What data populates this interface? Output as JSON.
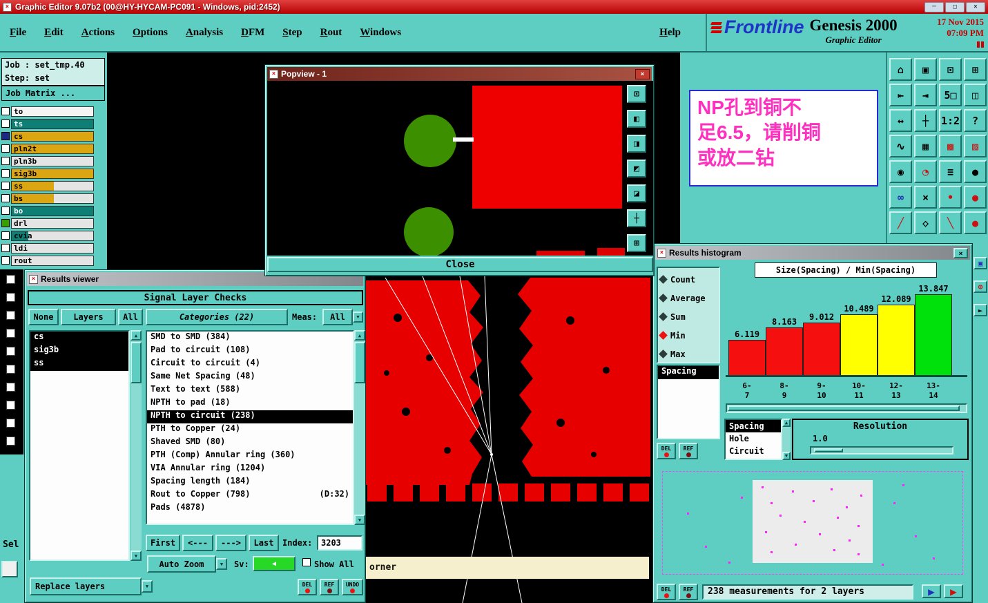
{
  "icons": {
    "app": "×",
    "minimize": "─",
    "maximize": "□",
    "close": "×",
    "up": "▲",
    "down": "▼",
    "left": "◀",
    "right": "▶",
    "dropdown": "▼",
    "window_icon": "×"
  },
  "window": {
    "title": "Graphic Editor 9.07b2 (00@HY-HYCAM-PC091 - Windows, pid:2452)"
  },
  "menubar": {
    "items": [
      "File",
      "Edit",
      "Actions",
      "Options",
      "Analysis",
      "DFM",
      "Step",
      "Rout",
      "Windows"
    ],
    "help": "Help"
  },
  "brand": {
    "logo": "Frontline",
    "product": "Genesis 2000",
    "date": "17 Nov 2015",
    "time": "07:09 PM",
    "subtitle": "Graphic Editor"
  },
  "job_panel": {
    "job": "Job : set_tmp.40",
    "step": "Step: set",
    "matrix": "Job Matrix ...",
    "sel_label": "Sel",
    "layers": [
      {
        "name": "to",
        "bar": "#f4f4f4",
        "fg": "#000000",
        "check": "#ffffff",
        "w": "100%"
      },
      {
        "name": "ts",
        "bar": "#0f7e75",
        "fg": "#ffffff",
        "check": "#ffffff",
        "w": "100%"
      },
      {
        "name": "cs",
        "bar": "#dca613",
        "fg": "#000000",
        "check": "#1b2a86",
        "w": "100%"
      },
      {
        "name": "pln2t",
        "bar": "#dca613",
        "fg": "#000000",
        "check": "#ffffff",
        "w": "100%"
      },
      {
        "name": "pln3b",
        "bar": "#e4e4e4",
        "fg": "#000000",
        "check": "#ffffff",
        "w": "100%"
      },
      {
        "name": "sig3b",
        "bar": "#dca613",
        "fg": "#000000",
        "check": "#ffffff",
        "w": "100%"
      },
      {
        "name": "ss",
        "bar": "#dca613",
        "fg": "#000000",
        "check": "#ffffff",
        "w": "52%"
      },
      {
        "name": "bs",
        "bar": "#dca613",
        "fg": "#000000",
        "check": "#ffffff",
        "w": "52%"
      },
      {
        "name": "bo",
        "bar": "#0f7e75",
        "fg": "#ffffff",
        "check": "#ffffff",
        "w": "100%"
      },
      {
        "name": "drl",
        "bar": "#e4e4e4",
        "fg": "#000000",
        "check": "#36a000",
        "w": "100%"
      },
      {
        "name": "cvia",
        "bar": "#0f7e75",
        "fg": "#000000",
        "check": "#ffffff",
        "w": "20%"
      },
      {
        "name": "ldi",
        "bar": "#e4e4e4",
        "fg": "#000000",
        "check": "#ffffff",
        "w": "100%"
      },
      {
        "name": "rout",
        "bar": "#e4e4e4",
        "fg": "#000000",
        "check": "#ffffff",
        "w": "100%"
      }
    ]
  },
  "popview": {
    "title": "Popview - 1",
    "close_label": "Close",
    "tools": [
      {
        "icon": "⊡",
        "name": "view-box-icon"
      },
      {
        "icon": "◧",
        "name": "half-left-icon"
      },
      {
        "icon": "◨",
        "name": "half-right-icon"
      },
      {
        "icon": "◩",
        "name": "corner-view-icon"
      },
      {
        "icon": "◪",
        "name": "corner-view2-icon"
      },
      {
        "icon": "┼",
        "name": "pan-cross-icon"
      },
      {
        "icon": "⊞",
        "name": "grid-center-icon"
      }
    ]
  },
  "results_viewer": {
    "title": "Results viewer",
    "header": "Signal Layer Checks",
    "none_btn": "None",
    "layers_btn": "Layers",
    "all_btn": "All",
    "categories_header": "Categories (22)",
    "meas_label": "Meas:",
    "meas_value": "All",
    "layer_items": [
      {
        "label": "cs"
      },
      {
        "label": "sig3b"
      },
      {
        "label": "ss"
      }
    ],
    "categories": [
      {
        "label": "SMD to SMD (384)",
        "extra": "",
        "selected": false
      },
      {
        "label": "Pad to circuit (108)",
        "extra": "",
        "selected": false
      },
      {
        "label": "Circuit to circuit (4)",
        "extra": "",
        "selected": false
      },
      {
        "label": "Same Net Spacing (48)",
        "extra": "",
        "selected": false
      },
      {
        "label": "Text to text (588)",
        "extra": "",
        "selected": false
      },
      {
        "label": "NPTH to pad (18)",
        "extra": "",
        "selected": false
      },
      {
        "label": "NPTH to circuit (238)",
        "extra": "",
        "selected": true
      },
      {
        "label": "PTH to Copper (24)",
        "extra": "",
        "selected": false
      },
      {
        "label": "Shaved SMD (80)",
        "extra": "",
        "selected": false
      },
      {
        "label": "PTH (Comp) Annular ring (360)",
        "extra": "",
        "selected": false
      },
      {
        "label": "VIA Annular ring (1204)",
        "extra": "",
        "selected": false
      },
      {
        "label": "Spacing length (184)",
        "extra": "",
        "selected": false
      },
      {
        "label": "Rout to Copper (798)",
        "extra": "(D:32)",
        "selected": false
      },
      {
        "label": "Pads (4878)",
        "extra": "",
        "selected": false
      }
    ],
    "nav": {
      "first": "First",
      "prev": "<---",
      "next": "--->",
      "last": "Last",
      "index_label": "Index:",
      "index_value": "3203"
    },
    "auto_zoom": "Auto Zoom",
    "sv_label": "Sv:",
    "sv_color": "#27d827",
    "show_all": "Show All",
    "replace_layers": "Replace layers",
    "del_btn": "DEL",
    "ref_btn": "REF",
    "undo_btn": "UNDO"
  },
  "histogram": {
    "title": "Results histogram",
    "stats": [
      {
        "label": "Count",
        "selected": false
      },
      {
        "label": "Average",
        "selected": false
      },
      {
        "label": "Sum",
        "selected": false
      },
      {
        "label": "Min",
        "selected": true
      },
      {
        "label": "Max",
        "selected": false
      }
    ],
    "series": [
      {
        "label": "Spacing",
        "selected": true
      }
    ],
    "measures": [
      {
        "label": "Spacing",
        "selected": true
      },
      {
        "label": "Hole",
        "selected": false
      },
      {
        "label": "Circuit",
        "selected": false
      }
    ],
    "resolution_label": "Resolution",
    "resolution_value": "1.0",
    "status": "238 measurements for 2 layers",
    "del_btn": "DEL",
    "ref_btn": "REF",
    "map_dots": [
      [
        33,
        14
      ],
      [
        43,
        18
      ],
      [
        56,
        16
      ],
      [
        66,
        22
      ],
      [
        36,
        30
      ],
      [
        50,
        28
      ],
      [
        61,
        34
      ],
      [
        39,
        42
      ],
      [
        47,
        48
      ],
      [
        58,
        44
      ],
      [
        65,
        52
      ],
      [
        34,
        58
      ],
      [
        52,
        60
      ],
      [
        62,
        66
      ],
      [
        44,
        70
      ],
      [
        57,
        76
      ],
      [
        36,
        78
      ],
      [
        65,
        80
      ],
      [
        26,
        24
      ],
      [
        8,
        40
      ],
      [
        14,
        72
      ],
      [
        22,
        88
      ],
      [
        77,
        30
      ],
      [
        84,
        62
      ],
      [
        90,
        84
      ],
      [
        73,
        90
      ],
      [
        80,
        12
      ]
    ]
  },
  "chart_data": {
    "type": "bar",
    "title": "Size(Spacing) / Min(Spacing)",
    "categories": [
      "6-\n 7",
      "8-\n 9",
      "9-\n 10",
      "10-\n 11",
      "12-\n 13",
      "13-\n 14"
    ],
    "values": [
      6.119,
      8.163,
      9.012,
      10.489,
      12.089,
      13.847
    ],
    "bar_colors": [
      "#f50f0f",
      "#f50f0f",
      "#f50f0f",
      "#ffff00",
      "#ffff00",
      "#00e10b"
    ],
    "ylim": [
      0,
      14.5
    ],
    "grid": false,
    "legend": null
  },
  "message": {
    "color": "#ff2fbf",
    "lines": [
      "NP孔到铜不",
      "足6.5，请削铜",
      "或放二钻"
    ]
  },
  "pcb_label": "orner",
  "toolbar": {
    "buttons": [
      {
        "icon": "⌂",
        "name": "home-view-icon",
        "fg": "",
        "bg": ""
      },
      {
        "icon": "▣",
        "name": "screen-icon",
        "fg": "",
        "bg": ""
      },
      {
        "icon": "⊡",
        "name": "page-view-icon",
        "fg": "",
        "bg": ""
      },
      {
        "icon": "⊞",
        "name": "tile-windows-icon",
        "fg": "",
        "bg": ""
      },
      {
        "icon": "⇤",
        "name": "dock-left-icon",
        "fg": "",
        "bg": ""
      },
      {
        "icon": "⇥",
        "name": "dock-right-icon",
        "fg": "",
        "bg": ""
      },
      {
        "icon": "5□",
        "name": "five-windows-icon",
        "fg": "",
        "bg": ""
      },
      {
        "icon": "◫",
        "name": "split-window-icon",
        "fg": "",
        "bg": ""
      },
      {
        "icon": "↔",
        "name": "expand-icon",
        "fg": "",
        "bg": ""
      },
      {
        "icon": "┼",
        "name": "crosshair-icon",
        "fg": "",
        "bg": ""
      },
      {
        "icon": "1:2",
        "name": "scale-ratio-icon",
        "fg": "",
        "bg": ""
      },
      {
        "icon": "?",
        "name": "help-icon",
        "fg": "",
        "bg": ""
      },
      {
        "icon": "∿",
        "name": "curve-icon",
        "fg": "",
        "bg": ""
      },
      {
        "icon": "▦",
        "name": "grid-icon",
        "fg": "",
        "bg": ""
      },
      {
        "icon": "▩",
        "name": "red-grid-icon",
        "fg": "#cc1111",
        "bg": ""
      },
      {
        "icon": "▨",
        "name": "hatch-grid-icon",
        "fg": "#cc1111",
        "bg": ""
      },
      {
        "icon": "◉",
        "name": "target-icon",
        "fg": "",
        "bg": "#ffffff"
      },
      {
        "icon": "◔",
        "name": "pie-icon",
        "fg": "#cc1111",
        "bg": "#ffffff"
      },
      {
        "icon": "≡",
        "name": "ruler-icon",
        "fg": "",
        "bg": "#ffffff"
      },
      {
        "icon": "●",
        "name": "filled-circle-icon",
        "fg": "",
        "bg": "#ffffff"
      },
      {
        "icon": "∞",
        "name": "net-links-icon",
        "fg": "#2233bb",
        "bg": "#ffffff"
      },
      {
        "icon": "×",
        "name": "delete-icon",
        "fg": "",
        "bg": "#ffffff"
      },
      {
        "icon": "•",
        "name": "small-dot-icon",
        "fg": "#cc1111",
        "bg": "#ffffff"
      },
      {
        "icon": "●",
        "name": "red-dot-icon",
        "fg": "#cc1111",
        "bg": "#ffffff"
      },
      {
        "icon": "╱",
        "name": "red-line-icon",
        "fg": "#cc1111",
        "bg": ""
      },
      {
        "icon": "◇",
        "name": "diamond-icon",
        "fg": "",
        "bg": ""
      },
      {
        "icon": "╲",
        "name": "line-icon",
        "fg": "#cc1111",
        "bg": ""
      },
      {
        "icon": "●",
        "name": "dot-icon",
        "fg": "#cc1111",
        "bg": ""
      }
    ],
    "side_buttons": [
      {
        "icon": "▣",
        "name": "blue-grid-icon",
        "fg": "#2233bb",
        "bg": ""
      },
      {
        "icon": "⊕",
        "name": "zoom-target-icon",
        "fg": "#cc1111",
        "bg": ""
      },
      {
        "icon": "►",
        "name": "cursor-icon",
        "fg": "#111111",
        "bg": ""
      }
    ]
  }
}
